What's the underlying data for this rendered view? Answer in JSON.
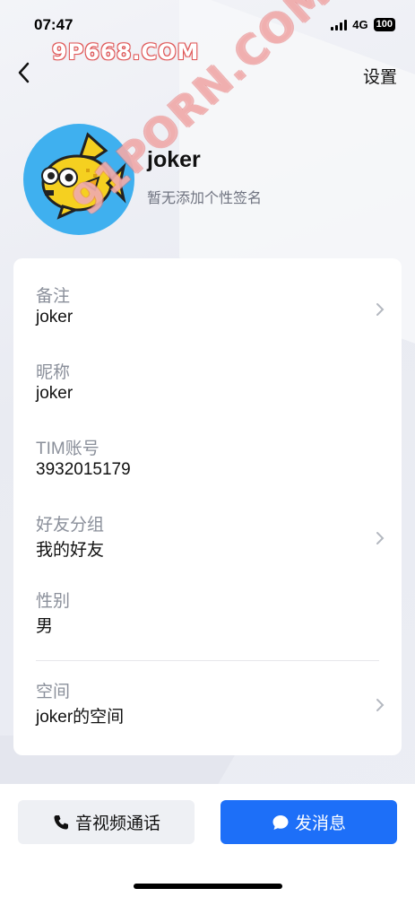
{
  "status_bar": {
    "time": "07:47",
    "network": "4G",
    "battery": "100"
  },
  "watermarks": {
    "top": "9P668.COM",
    "diagonal": "91PORN.COM"
  },
  "nav": {
    "settings_label": "设置"
  },
  "profile": {
    "name": "joker",
    "signature": "暂无添加个性签名",
    "avatar_icon": "pixel-fish-avatar"
  },
  "details": [
    {
      "label": "备注",
      "value": "joker",
      "has_chevron": true
    },
    {
      "label": "昵称",
      "value": "joker",
      "has_chevron": false
    },
    {
      "label": "TIM账号",
      "value": "3932015179",
      "has_chevron": false
    },
    {
      "label": "好友分组",
      "value": "我的好友",
      "has_chevron": true
    },
    {
      "label": "性别",
      "value": "男",
      "has_chevron": false
    },
    {
      "label": "空间",
      "value": "joker的空间",
      "has_chevron": true
    }
  ],
  "actions": {
    "call_label": "音视频通话",
    "message_label": "发消息"
  },
  "colors": {
    "primary": "#1d6ff8",
    "avatar_bg": "#3fb0ef",
    "fish": "#f5d020"
  }
}
